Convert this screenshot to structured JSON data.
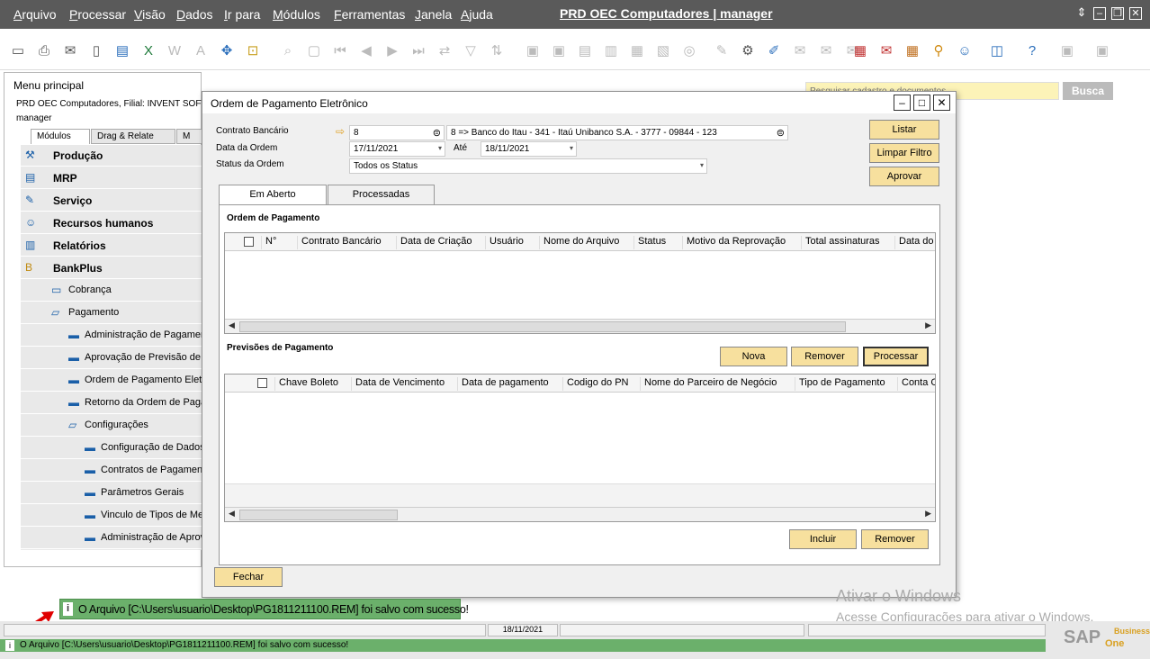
{
  "menubar": {
    "items": [
      "Arquivo",
      "Processar",
      "Visão",
      "Dados",
      "Ir para",
      "Módulos",
      "Ferramentas",
      "Janela",
      "Ajuda"
    ],
    "title": "PRD OEC Computadores | manager"
  },
  "search": {
    "placeholder": "Pesquisar cadastro e documentos",
    "button": "Busca"
  },
  "mainmenu": {
    "title": "Menu principal",
    "company": "PRD OEC Computadores, Filial: INVENT SOFT",
    "user": "manager",
    "tabs": [
      "Módulos",
      "Drag & Relate",
      "M"
    ],
    "items": [
      {
        "label": "Produção",
        "icon": "production-icon"
      },
      {
        "label": "MRP",
        "icon": "mrp-icon"
      },
      {
        "label": "Serviço",
        "icon": "service-icon"
      },
      {
        "label": "Recursos humanos",
        "icon": "hr-icon"
      },
      {
        "label": "Relatórios",
        "icon": "reports-icon"
      },
      {
        "label": "BankPlus",
        "icon": "bankplus-icon"
      },
      {
        "label": "Cobrança",
        "icon": "folder-icon"
      },
      {
        "label": "Pagamento",
        "icon": "folder-open-icon"
      },
      {
        "label": "Administração de Pagamentos",
        "icon": "window-icon"
      },
      {
        "label": "Aprovação de Previsão de Pagamento",
        "icon": "window-icon"
      },
      {
        "label": "Ordem de Pagamento Eletrônico",
        "icon": "window-icon"
      },
      {
        "label": "Retorno da Ordem de Pagamento",
        "icon": "window-icon"
      },
      {
        "label": "Configurações",
        "icon": "folder-open-icon"
      },
      {
        "label": "Configuração de Dados",
        "icon": "window-icon"
      },
      {
        "label": "Contratos de Pagamento",
        "icon": "window-icon"
      },
      {
        "label": "Parâmetros Gerais",
        "icon": "window-icon"
      },
      {
        "label": "Vinculo de Tipos de Meio",
        "icon": "window-icon"
      },
      {
        "label": "Administração de Aprovação",
        "icon": "window-icon"
      }
    ]
  },
  "dialog": {
    "title": "Ordem de Pagamento Eletrônico",
    "labels": {
      "contrato": "Contrato Bancário",
      "data_ordem": "Data da Ordem",
      "ate": "Até",
      "status": "Status da Ordem"
    },
    "values": {
      "contrato": "8",
      "contrato_desc": "8 => Banco do Itau - 341 - Itaú Unibanco  S.A. - 3777 - 09844 - 123",
      "data_de": "17/11/2021",
      "data_ate": "18/11/2021",
      "status": "Todos os Status"
    },
    "buttons": {
      "listar": "Listar",
      "limpar": "Limpar Filtro",
      "aprovar": "Aprovar",
      "nova": "Nova",
      "remover": "Remover",
      "processar": "Processar",
      "incluir": "Incluir",
      "remover2": "Remover",
      "fechar": "Fechar"
    },
    "tabs": [
      "Em Aberto",
      "Processadas"
    ],
    "section1": "Ordem de Pagamento",
    "grid1_cols": [
      "N°",
      "Contrato Bancário",
      "Data de Criação",
      "Usuário",
      "Nome do Arquivo",
      "Status",
      "Motivo da Reprovação",
      "Total assinaturas",
      "Data do"
    ],
    "section2": "Previsões de Pagamento",
    "grid2_cols": [
      "Chave Boleto",
      "Data de Vencimento",
      "Data de pagamento",
      "Codigo do PN",
      "Nome do Parceiro de Negócio",
      "Tipo de Pagamento",
      "Conta C"
    ]
  },
  "toast": "O Arquivo [C:\\Users\\usuario\\Desktop\\PG1811211100.REM] foi salvo com sucesso!",
  "statusbar": {
    "date": "18/11/2021",
    "message": "O Arquivo [C:\\Users\\usuario\\Desktop\\PG1811211100.REM] foi salvo com sucesso!"
  },
  "watermark": {
    "line1": "Ativar o Windows",
    "line2": "Acesse Configurações para ativar o Windows."
  },
  "brand": {
    "sap": "SAP",
    "business": "Business",
    "one": "One"
  }
}
